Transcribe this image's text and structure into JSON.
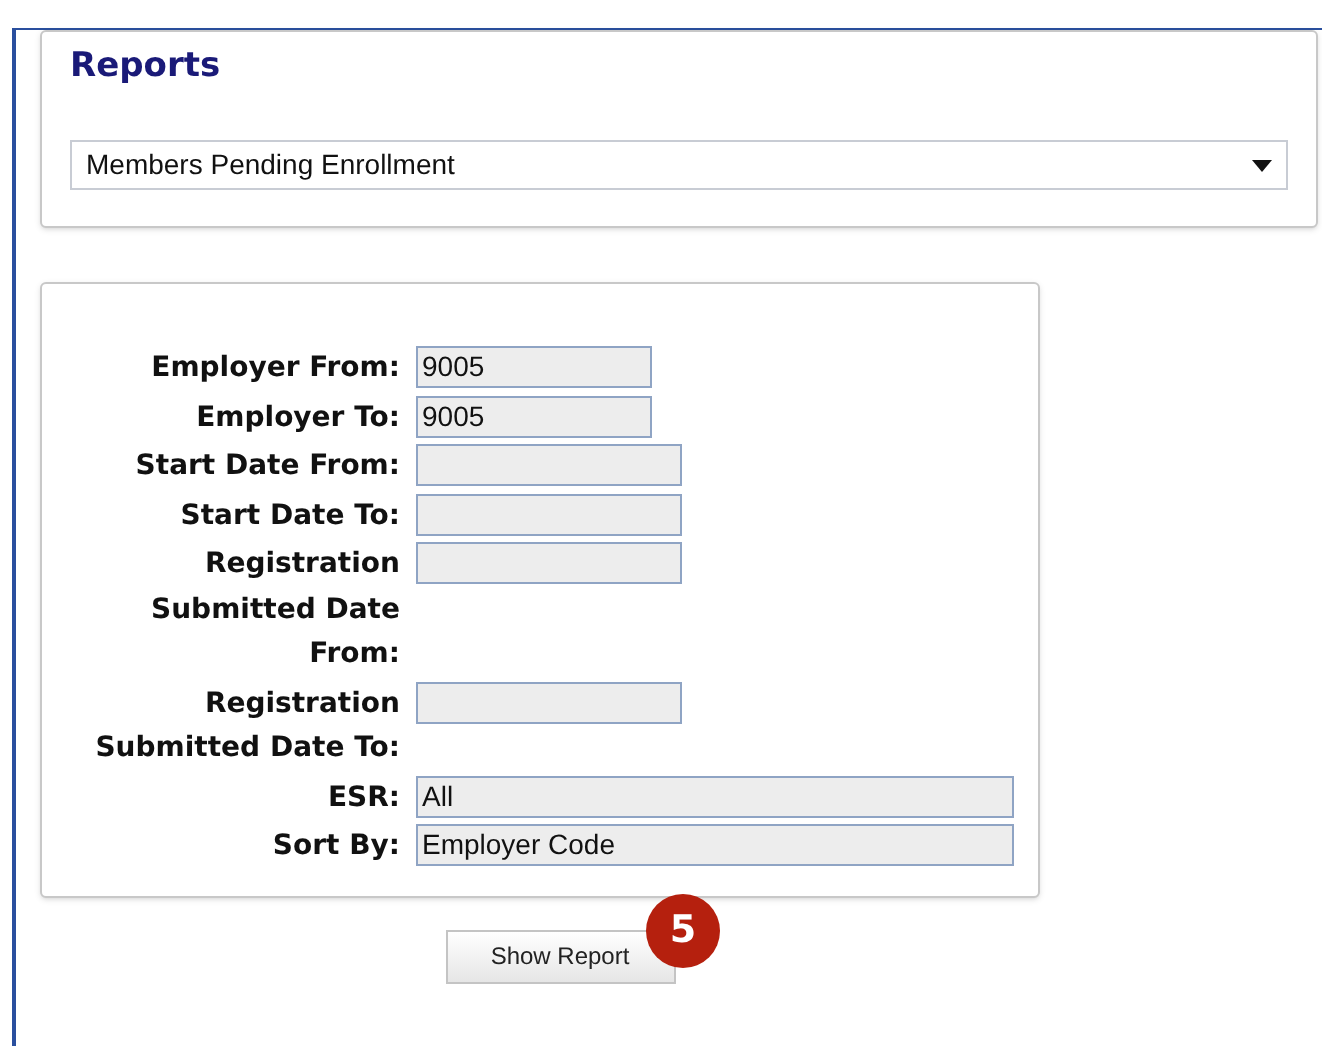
{
  "reports": {
    "title": "Reports",
    "report_select": {
      "value": "Members Pending Enrollment"
    }
  },
  "form": {
    "fields": [
      {
        "label": "Employer From:",
        "value": "9005",
        "kind": "short"
      },
      {
        "label": "Employer To:",
        "value": "9005",
        "kind": "short"
      },
      {
        "label": "Start Date From:",
        "kind": "medium"
      },
      {
        "label": "Start Date To:",
        "kind": "medium"
      },
      {
        "label": "Registration Submitted Date From:",
        "kind": "medium"
      },
      {
        "label": "Registration Submitted Date To:",
        "kind": "medium"
      },
      {
        "label": "ESR:",
        "value": "All",
        "kind": "long"
      },
      {
        "label": "Sort By:",
        "value": "Employer Code",
        "kind": "long"
      }
    ]
  },
  "step_badge": "5",
  "show_report_button": "Show Report"
}
